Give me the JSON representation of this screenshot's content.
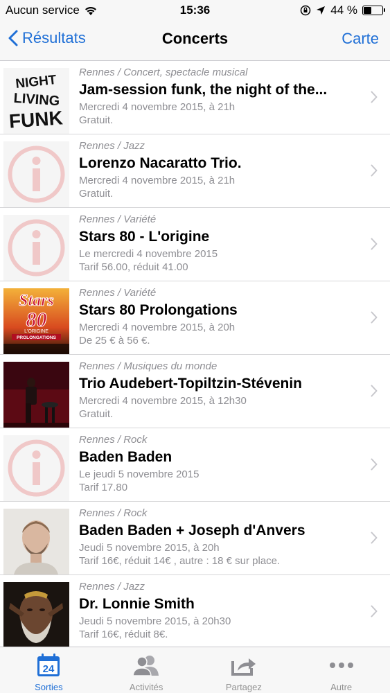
{
  "status_bar": {
    "carrier": "Aucun service",
    "time": "15:36",
    "battery": "44 %",
    "battery_level": 0.44
  },
  "nav": {
    "back_label": "Résultats",
    "title": "Concerts",
    "right_label": "Carte"
  },
  "colors": {
    "accent": "#1f6fd6",
    "secondary_text": "#8e8e93",
    "placeholder_red": "#f2c4c4"
  },
  "events": [
    {
      "category": "Rennes / Concert, spectacle musical",
      "title": "Jam-session funk, the night of the...",
      "date": "Mercredi 4 novembre 2015, à 21h",
      "price": "Gratuit.",
      "thumbnail": "night-of-the-living-funk-logo",
      "thumbnail_lines": [
        "NIGHT",
        "LIVING",
        "FUNK"
      ]
    },
    {
      "category": "Rennes / Jazz",
      "title": "Lorenzo Nacaratto Trio.",
      "date": "Mercredi 4 novembre 2015, à 21h",
      "price": "Gratuit.",
      "thumbnail": "info-placeholder"
    },
    {
      "category": "Rennes / Variété",
      "title": "Stars 80 - L'origine",
      "date": "Le mercredi 4 novembre 2015",
      "price": "Tarif 56.00, réduit 41.00",
      "thumbnail": "info-placeholder"
    },
    {
      "category": "Rennes / Variété",
      "title": "Stars 80 Prolongations",
      "date": "Mercredi 4 novembre 2015, à 20h",
      "price": "De 25 € à 56 €.",
      "thumbnail": "stars-80-poster",
      "thumbnail_lines": [
        "Stars",
        "80",
        "L'ORIGINE",
        "PROLONGATIONS"
      ]
    },
    {
      "category": "Rennes / Musiques du monde",
      "title": "Trio Audebert-Topiltzin-Stévenin",
      "date": "Mercredi 4 novembre 2015, à 12h30",
      "price": "Gratuit.",
      "thumbnail": "stage-photo"
    },
    {
      "category": "Rennes / Rock",
      "title": "Baden Baden",
      "date": "Le jeudi 5 novembre 2015",
      "price": "Tarif 17.80",
      "thumbnail": "info-placeholder"
    },
    {
      "category": "Rennes / Rock",
      "title": "Baden Baden + Joseph d'Anvers",
      "date": "Jeudi 5 novembre 2015, à 20h",
      "price": "Tarif 16€, réduit 14€ , autre : 18 € sur place.",
      "thumbnail": "portrait-photo"
    },
    {
      "category": "Rennes / Jazz",
      "title": "Dr. Lonnie Smith",
      "date": "Jeudi 5 novembre 2015, à 20h30",
      "price": "Tarif 16€, réduit 8€.",
      "thumbnail": "portrait-dark-photo"
    }
  ],
  "tabs": [
    {
      "label": "Sorties",
      "icon": "calendar-icon",
      "badge": "24",
      "active": true
    },
    {
      "label": "Activités",
      "icon": "people-icon",
      "active": false
    },
    {
      "label": "Partagez",
      "icon": "share-icon",
      "active": false
    },
    {
      "label": "Autre",
      "icon": "more-icon",
      "active": false
    }
  ]
}
